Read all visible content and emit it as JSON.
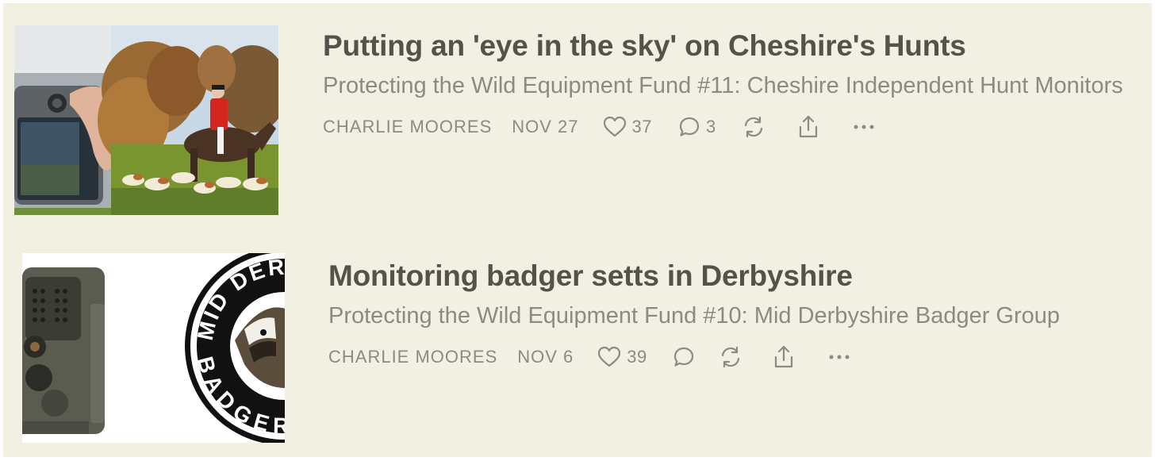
{
  "posts": [
    {
      "title": "Putting an 'eye in the sky' on Cheshire's Hunts",
      "subtitle": "Protecting the Wild Equipment Fund #11: Cheshire Independent Hunt Monitors",
      "author": "CHARLIE MOORES",
      "date": "NOV 27",
      "likes": "37",
      "comments": "3",
      "thumbnail": "drone controller screen beside a mounted huntsman in red coat with hounds"
    },
    {
      "title": "Monitoring badger setts in Derbyshire",
      "subtitle": "Protecting the Wild Equipment Fund #10: Mid Derbyshire Badger Group",
      "author": "CHARLIE MOORES",
      "date": "NOV 6",
      "likes": "39",
      "comments": "",
      "thumbnail": "trail camera beside the Mid Derbyshire Badger Group logo",
      "logo_text": "MID DERBYSHIRE BADGER GROUP"
    }
  ],
  "icons": {
    "like": "heart-icon",
    "comment": "comment-icon",
    "restack": "restack-icon",
    "share": "share-icon",
    "more": "more-icon"
  },
  "colors": {
    "background": "#f1f0e2",
    "title": "#53534c",
    "muted": "#8b8b83"
  }
}
